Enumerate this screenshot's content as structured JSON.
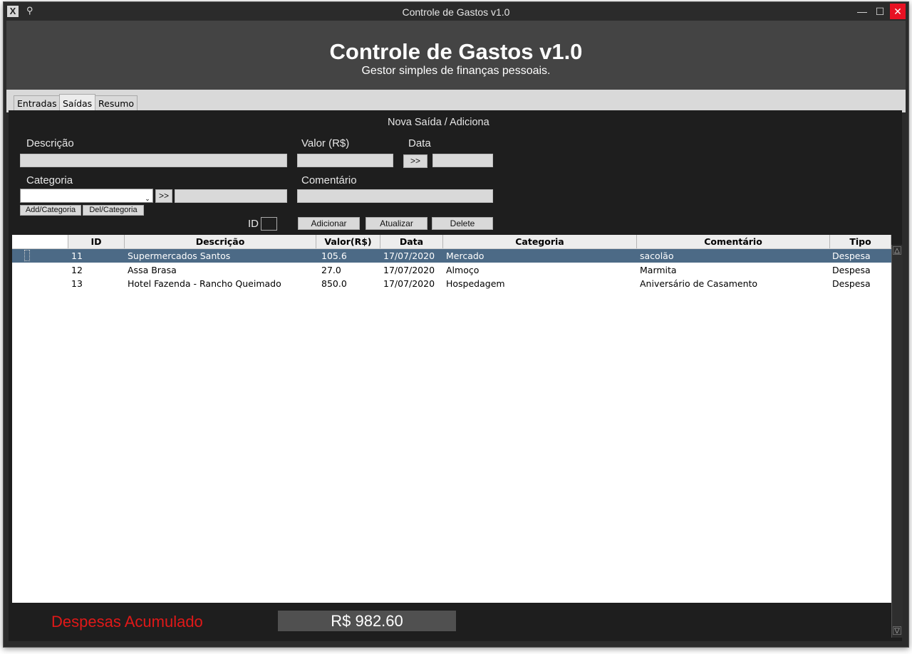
{
  "window": {
    "title": "Controle de Gastos v1.0",
    "icon": "x-app-icon",
    "pin_glyph": "⚲",
    "min_glyph": "—",
    "max_glyph": "☐",
    "close_glyph": "✕"
  },
  "header": {
    "title": "Controle de Gastos v1.0",
    "subtitle": "Gestor simples de finanças pessoais."
  },
  "tabs": [
    {
      "label": "Entradas",
      "active": false
    },
    {
      "label": "Saídas",
      "active": true
    },
    {
      "label": "Resumo",
      "active": false
    }
  ],
  "form": {
    "section_title": "Nova Saída / Adiciona",
    "descricao_label": "Descrição",
    "descricao_value": "",
    "valor_label": "Valor (R$)",
    "valor_value": "",
    "data_label": "Data",
    "data_button": ">>",
    "data_value": "",
    "categoria_label": "Categoria",
    "categoria_selected": "",
    "categoria_arrow": "⌄",
    "categoria_button": ">>",
    "categoria_new_value": "",
    "comentario_label": "Comentário",
    "comentario_value": "",
    "add_categoria_button": "Add/Categoria",
    "del_categoria_button": "Del/Categoria",
    "id_label": "ID",
    "id_value": "",
    "adicionar_button": "Adicionar",
    "atualizar_button": "Atualizar",
    "delete_button": "Delete"
  },
  "table": {
    "columns": [
      "ID",
      "Descrição",
      "Valor(R$)",
      "Data",
      "Categoria",
      "Comentário",
      "Tipo"
    ],
    "rows": [
      {
        "id": "11",
        "descricao": "Supermercados Santos",
        "valor": "105.6",
        "data": "17/07/2020",
        "categoria": "Mercado",
        "comentario": "sacolão",
        "tipo": "Despesa",
        "selected": true
      },
      {
        "id": "12",
        "descricao": "Assa Brasa",
        "valor": "27.0",
        "data": "17/07/2020",
        "categoria": "Almoço",
        "comentario": "Marmita",
        "tipo": "Despesa",
        "selected": false
      },
      {
        "id": "13",
        "descricao": "Hotel Fazenda - Rancho Queimado",
        "valor": "850.0",
        "data": "17/07/2020",
        "categoria": "Hospedagem",
        "comentario": "Aniversário de Casamento",
        "tipo": "Despesa",
        "selected": false
      }
    ]
  },
  "scrollbar": {
    "up_glyph": "△",
    "down_glyph": "▽"
  },
  "footer": {
    "label": "Despesas Acumulado",
    "total": "R$ 982.60"
  },
  "colors": {
    "selected_row": "#4c6a86",
    "total_label": "#e01818",
    "header_bg": "#444444",
    "panel_bg": "#1e1e1e",
    "close_button": "#e81123"
  }
}
